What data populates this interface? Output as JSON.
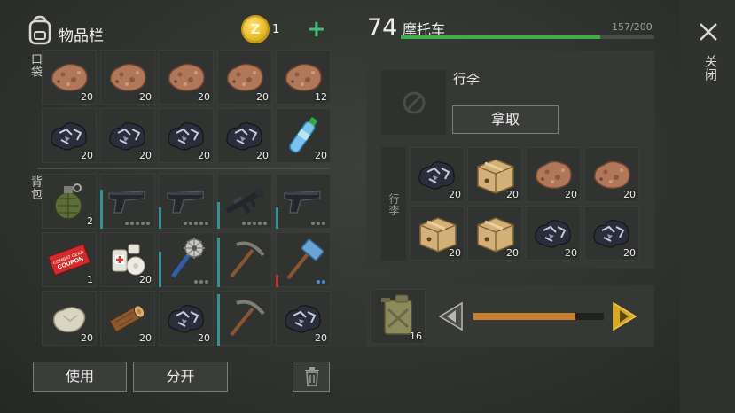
{
  "inventory": {
    "title": "物品栏",
    "coins": "1",
    "pocket_label": "口袋",
    "backpack_label": "背包",
    "pocket_slots": [
      {
        "item": "stone",
        "count": "20"
      },
      {
        "item": "stone",
        "count": "20"
      },
      {
        "item": "stone",
        "count": "20"
      },
      {
        "item": "stone",
        "count": "20"
      },
      {
        "item": "stone",
        "count": "12"
      },
      {
        "item": "coal",
        "count": "20"
      },
      {
        "item": "coal",
        "count": "20"
      },
      {
        "item": "coal",
        "count": "20"
      },
      {
        "item": "coal",
        "count": "20"
      },
      {
        "item": "water-bottle",
        "count": "20"
      }
    ],
    "backpack_slots": [
      {
        "item": "grenade",
        "count": "2"
      },
      {
        "item": "pistol",
        "count": ""
      },
      {
        "item": "pistol",
        "count": ""
      },
      {
        "item": "rifle",
        "count": ""
      },
      {
        "item": "pistol",
        "count": ""
      },
      {
        "item": "coupon",
        "count": "1"
      },
      {
        "item": "bandage",
        "count": "20"
      },
      {
        "item": "saw-mace",
        "count": ""
      },
      {
        "item": "pickaxe",
        "count": ""
      },
      {
        "item": "sledgehammer",
        "count": ""
      },
      {
        "item": "limestone",
        "count": "20"
      },
      {
        "item": "log",
        "count": "20"
      },
      {
        "item": "coal",
        "count": "20"
      },
      {
        "item": "pickaxe",
        "count": ""
      },
      {
        "item": "coal",
        "count": "20"
      }
    ],
    "use_label": "使用",
    "split_label": "分开"
  },
  "vehicle": {
    "level": "74",
    "name": "摩托车",
    "capacity": "157/200",
    "capacity_fraction": 0.785,
    "luggage_title": "行李",
    "take_label": "拿取",
    "luggage_side_label": "行李",
    "luggage_slots": [
      {
        "item": "coal",
        "count": "20"
      },
      {
        "item": "box",
        "count": "20"
      },
      {
        "item": "stone",
        "count": "20"
      },
      {
        "item": "stone",
        "count": "20"
      },
      {
        "item": "box",
        "count": "20"
      },
      {
        "item": "box",
        "count": "20"
      },
      {
        "item": "coal",
        "count": "20"
      },
      {
        "item": "coal",
        "count": "20"
      }
    ],
    "fuel_count": "16",
    "fuel_level_fraction": 0.78
  },
  "close_label": "关闭",
  "colors": {
    "accent_green": "#3fae44",
    "fuel_orange": "#c9812f",
    "coin_gold": "#e8b923",
    "plus_green": "#3fbf7a"
  }
}
